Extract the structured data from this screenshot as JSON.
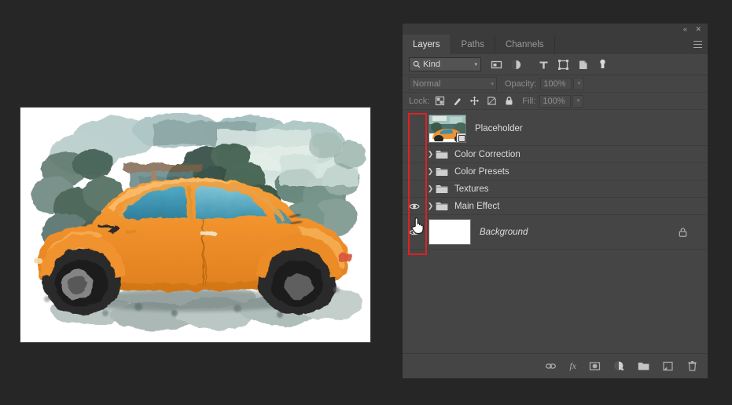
{
  "app": {
    "panel_title": "Layers",
    "background_color": "#262626",
    "panel_color": "#454545",
    "accent_highlight": "#e02020"
  },
  "panel_header": {
    "collapse_icon": "double-chevron-collapse-icon",
    "close_icon": "close-icon",
    "menu_icon": "panel-menu-icon",
    "tabs": [
      {
        "label": "Layers",
        "active": true
      },
      {
        "label": "Paths",
        "active": false
      },
      {
        "label": "Channels",
        "active": false
      }
    ]
  },
  "filter_bar": {
    "search_icon": "search-icon",
    "kind_label": "Kind",
    "caret": "▾",
    "type_filters": [
      {
        "name": "filter-pixel-icon"
      },
      {
        "name": "filter-adjustment-icon"
      },
      {
        "name": "filter-type-icon"
      },
      {
        "name": "filter-shape-icon"
      },
      {
        "name": "filter-smart-object-icon"
      }
    ],
    "toggle_icon": "filter-toggle-switch-icon"
  },
  "blend_row": {
    "blend_mode": "Normal",
    "opacity_label": "Opacity:",
    "opacity_value": "100%",
    "caret": "▾"
  },
  "lock_row": {
    "lock_label": "Lock:",
    "lock_icons": [
      {
        "name": "lock-transparent-pixels-icon"
      },
      {
        "name": "lock-image-pixels-icon"
      },
      {
        "name": "lock-position-icon"
      },
      {
        "name": "lock-artboard-nesting-icon"
      },
      {
        "name": "lock-all-icon"
      }
    ],
    "fill_label": "Fill:",
    "fill_value": "100%",
    "caret": "▾"
  },
  "layers": [
    {
      "name": "Placeholder",
      "type": "smart-object",
      "visible": false,
      "has_thumbnail": true,
      "italic": false,
      "locked": false,
      "expandable": false
    },
    {
      "name": "Color Correction",
      "type": "group",
      "visible": false,
      "has_thumbnail": false,
      "italic": false,
      "locked": false,
      "expandable": true
    },
    {
      "name": "Color Presets",
      "type": "group",
      "visible": false,
      "has_thumbnail": false,
      "italic": false,
      "locked": false,
      "expandable": true
    },
    {
      "name": "Textures",
      "type": "group",
      "visible": false,
      "has_thumbnail": false,
      "italic": false,
      "locked": false,
      "expandable": true
    },
    {
      "name": "Main Effect",
      "type": "group",
      "visible": true,
      "has_thumbnail": false,
      "italic": false,
      "locked": false,
      "expandable": true
    },
    {
      "name": "Background",
      "type": "raster",
      "visible": true,
      "has_thumbnail": true,
      "italic": true,
      "locked": true,
      "expandable": false
    }
  ],
  "bottom_toolbar": [
    {
      "name": "link-layers-icon",
      "label": ""
    },
    {
      "name": "layer-style-fx-icon",
      "label": "fx"
    },
    {
      "name": "add-layer-mask-icon",
      "label": ""
    },
    {
      "name": "new-adjustment-layer-icon",
      "label": ""
    },
    {
      "name": "new-group-icon",
      "label": ""
    },
    {
      "name": "new-layer-icon",
      "label": ""
    },
    {
      "name": "delete-layer-icon",
      "label": ""
    }
  ],
  "annotation": {
    "highlight_region": "layer-visibility-column",
    "cursor": "pointing-hand-cursor"
  },
  "canvas": {
    "artwork_title": "Watercolor painted orange Volkswagen Beetle",
    "background": "#ffffff"
  }
}
